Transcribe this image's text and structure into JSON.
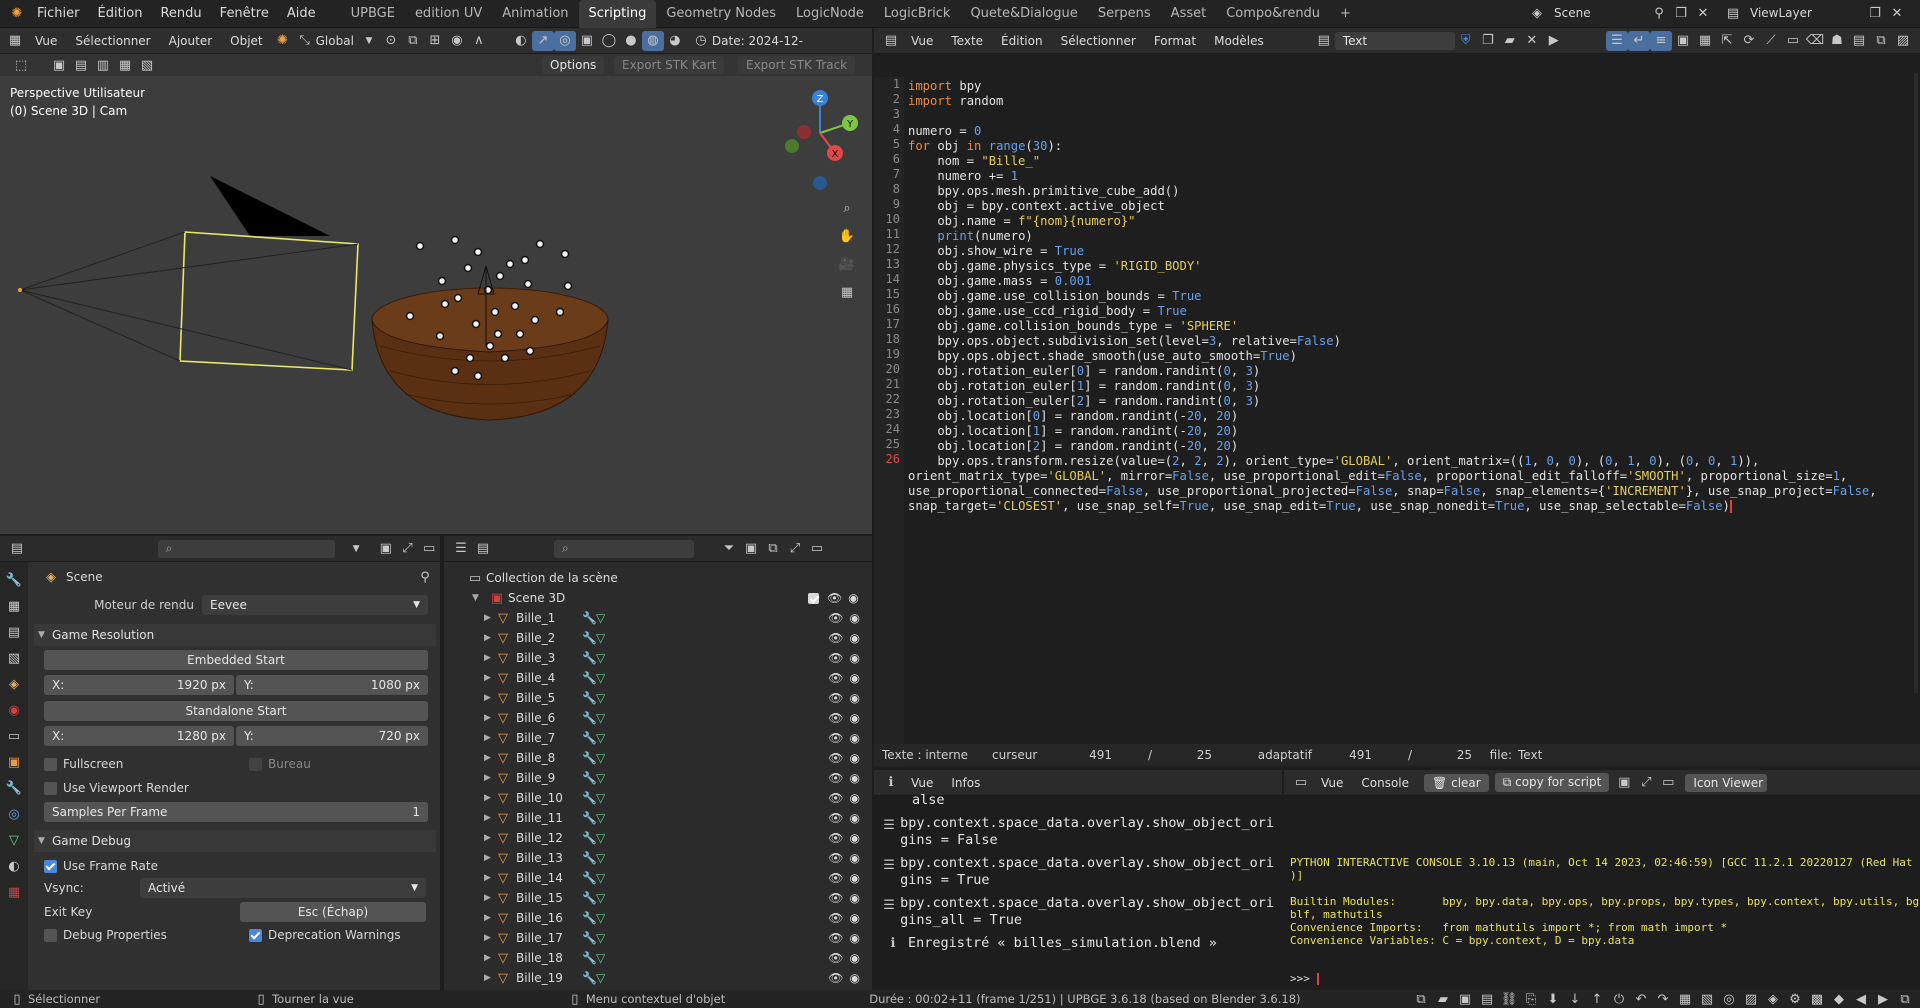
{
  "topbar": {
    "menus": [
      "Fichier",
      "Édition",
      "Rendu",
      "Fenêtre",
      "Aide"
    ],
    "workspaces": [
      "UPBGE",
      "edition UV",
      "Animation",
      "Scripting",
      "Geometry Nodes",
      "LogicNode",
      "LogicBrick",
      "Quete&Dialogue",
      "Serpens",
      "Asset",
      "Compo&rendu"
    ],
    "active_workspace": "Scripting",
    "add_tab": "+",
    "scene": "Scene",
    "view_layer": "ViewLayer"
  },
  "viewport": {
    "menus": [
      "Vue",
      "Sélectionner",
      "Ajouter",
      "Objet"
    ],
    "orientation": "Global",
    "date": "Date: 2024-12-",
    "options": "Options",
    "export_kart": "Export STK Kart",
    "export_track": "Export STK Track",
    "overlay_title": "Perspective Utilisateur",
    "overlay_sub": "(0) Scene 3D | Cam",
    "gizmo": {
      "x": "X",
      "y": "Y",
      "z": "Z"
    }
  },
  "text_editor": {
    "menus": [
      "Vue",
      "Texte",
      "Édition",
      "Sélectionner",
      "Format",
      "Modèles"
    ],
    "text_name": "Text",
    "lines": [
      "import bpy",
      "import random",
      "",
      "numero = 0",
      "for obj in range(30):",
      "    nom = \"Bille_\"",
      "    numero += 1",
      "    bpy.ops.mesh.primitive_cube_add()",
      "    obj = bpy.context.active_object",
      "    obj.name = f\"{nom}{numero}\"",
      "    print(numero)",
      "    obj.show_wire = True",
      "    obj.game.physics_type = 'RIGID_BODY'",
      "    obj.game.mass = 0.001",
      "    obj.game.use_collision_bounds = True",
      "    obj.game.use_ccd_rigid_body = True",
      "    obj.game.collision_bounds_type = 'SPHERE'",
      "    bpy.ops.object.subdivision_set(level=3, relative=False)",
      "    bpy.ops.object.shade_smooth(use_auto_smooth=True)",
      "    obj.rotation_euler[0] = random.randint(0, 3)",
      "    obj.rotation_euler[1] = random.randint(0, 3)",
      "    obj.rotation_euler[2] = random.randint(0, 3)",
      "    obj.location[0] = random.randint(-20, 20)",
      "    obj.location[1] = random.randint(-20, 20)",
      "    obj.location[2] = random.randint(-20, 20)",
      "    bpy.ops.transform.resize(value=(2, 2, 2), orient_type='GLOBAL', orient_matrix=((1, 0, 0), (0, 1, 0), (0, 0, 1)),",
      "orient_matrix_type='GLOBAL', mirror=False, use_proportional_edit=False, proportional_edit_falloff='SMOOTH', proportional_size=1,",
      "use_proportional_connected=False, use_proportional_projected=False, snap=False, snap_elements={'INCREMENT'}, use_snap_project=False,",
      "snap_target='CLOSEST', use_snap_self=True, use_snap_edit=True, use_snap_nonedit=True, use_snap_selectable=False)"
    ],
    "line_numbers": [
      "1",
      "2",
      "3",
      "4",
      "5",
      "6",
      "7",
      "8",
      "9",
      "10",
      "11",
      "12",
      "13",
      "14",
      "15",
      "16",
      "17",
      "18",
      "19",
      "20",
      "21",
      "22",
      "23",
      "24",
      "25",
      "26",
      "",
      "",
      ""
    ],
    "footer": {
      "internal": "Texte : interne",
      "cursor": "curseur",
      "c1": "491",
      "sep1": "/",
      "c2": "25",
      "mode": "adaptatif",
      "c3": "491",
      "sep2": "/",
      "c4": "25",
      "file": "file:",
      "file_name": "Text"
    }
  },
  "properties": {
    "scene_label": "Scene",
    "render_engine_label": "Moteur de rendu",
    "render_engine": "Eevee",
    "game_resolution": "Game Resolution",
    "embedded_start": "Embedded Start",
    "emb_x_label": "X:",
    "emb_x": "1920 px",
    "emb_y_label": "Y:",
    "emb_y": "1080 px",
    "standalone_start": "Standalone Start",
    "sa_x_label": "X:",
    "sa_x": "1280 px",
    "sa_y_label": "Y:",
    "sa_y": "720 px",
    "fullscreen": "Fullscreen",
    "bureau": "Bureau",
    "use_viewport_render": "Use Viewport Render",
    "samples_label": "Samples Per Frame",
    "samples": "1",
    "game_debug": "Game Debug",
    "use_frame_rate": "Use Frame Rate",
    "vsync_label": "Vsync:",
    "vsync": "Activé",
    "exit_key_label": "Exit Key",
    "exit_key": "Esc (Échap)",
    "debug_properties": "Debug Properties",
    "deprecation_warnings": "Deprecation Warnings"
  },
  "outliner": {
    "collection": "Collection de la scène",
    "scene3d": "Scene 3D",
    "items": [
      "Bille_1",
      "Bille_2",
      "Bille_3",
      "Bille_4",
      "Bille_5",
      "Bille_6",
      "Bille_7",
      "Bille_8",
      "Bille_9",
      "Bille_10",
      "Bille_11",
      "Bille_12",
      "Bille_13",
      "Bille_14",
      "Bille_15",
      "Bille_16",
      "Bille_17",
      "Bille_18",
      "Bille_19"
    ]
  },
  "info": {
    "menus": [
      "Vue",
      "Infos"
    ],
    "partial": "alse",
    "entries": [
      "bpy.context.space_data.overlay.show_object_ori\ngins = False",
      "bpy.context.space_data.overlay.show_object_ori\ngins = True",
      "bpy.context.space_data.overlay.show_object_ori\ngins_all = True"
    ],
    "saved": "Enregistré « billes_simulation.blend »"
  },
  "console": {
    "menus": [
      "Vue",
      "Console"
    ],
    "clear": "clear",
    "copy_for_script": "copy for script",
    "icon_viewer": "Icon Viewer",
    "lines": [
      "PYTHON INTERACTIVE CONSOLE 3.10.13 (main, Oct 14 2023, 02:46:59) [GCC 11.2.1 20220127 (Red Hat 11.2.1-9",
      ")]",
      "",
      "Builtin Modules:       bpy, bpy.data, bpy.ops, bpy.props, bpy.types, bpy.context, bpy.utils, bgl, gpu,",
      "blf, mathutils",
      "Convenience Imports:   from mathutils import *; from math import *",
      "Convenience Variables: C = bpy.context, D = bpy.data"
    ],
    "prompt": ">>> "
  },
  "statusbar": {
    "select": "Sélectionner",
    "rotate": "Tourner la vue",
    "context_menu": "Menu contextuel d'objet",
    "duration": "Durée : 00:02+11 (frame 1/251) | UPBGE 3.6.18 (based on Blender 3.6.18)"
  },
  "colors": {
    "accent": "#4a88e0",
    "orange": "#e89b4a",
    "bg": "#1d1d1d"
  }
}
